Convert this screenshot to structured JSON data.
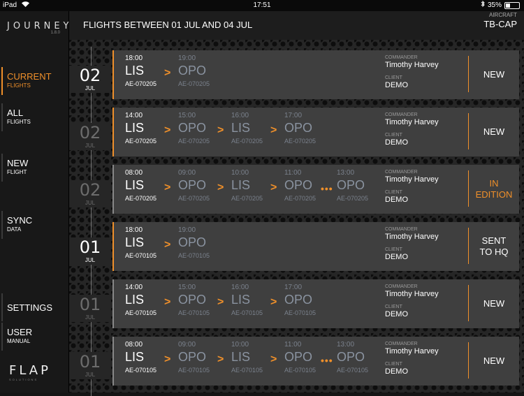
{
  "status_bar": {
    "device": "iPad",
    "time": "17:51",
    "battery": "35%",
    "battery_level": 0.35
  },
  "app": {
    "logo": "JOURNEY",
    "version": "1.8.0",
    "brand": "FLAP",
    "brand_sub": "SOLUTIONS"
  },
  "sidebar": {
    "items": [
      {
        "line1": "CURRENT",
        "line2": "FLIGHTS",
        "active": true
      },
      {
        "line1": "ALL",
        "line2": "FLIGHTS",
        "active": false
      },
      {
        "line1": "NEW",
        "line2": "FLIGHT",
        "active": false
      },
      {
        "line1": "SYNC",
        "line2": "DATA",
        "active": false
      },
      {
        "line1": "SETTINGS",
        "line2": "",
        "active": false
      },
      {
        "line1": "USER",
        "line2": "MANUAL",
        "active": false
      }
    ]
  },
  "header": {
    "title": "FLIGHTS BETWEEN 01 JUL AND 04 JUL",
    "aircraft_label": "AIRCRAFT",
    "aircraft": "TB-CAP"
  },
  "labels": {
    "commander": "COMMANDER",
    "client": "CLIENT"
  },
  "flights": [
    {
      "day": "02",
      "month": "JUL",
      "date_bright": true,
      "legs": [
        {
          "time": "18:00",
          "airport": "LIS",
          "flight": "AE-070205"
        },
        {
          "time": "19:00",
          "airport": "OPO",
          "flight": "AE-070205"
        }
      ],
      "seps": [
        ">"
      ],
      "commander": "Timothy Harvey",
      "client": "DEMO",
      "status": "NEW",
      "status_orange": false
    },
    {
      "day": "02",
      "month": "JUL",
      "date_bright": false,
      "legs": [
        {
          "time": "14:00",
          "airport": "LIS",
          "flight": "AE-070205"
        },
        {
          "time": "15:00",
          "airport": "OPO",
          "flight": "AE-070205"
        },
        {
          "time": "16:00",
          "airport": "LIS",
          "flight": "AE-070205"
        },
        {
          "time": "17:00",
          "airport": "OPO",
          "flight": "AE-070205"
        }
      ],
      "seps": [
        ">",
        ">",
        ">"
      ],
      "commander": "Timothy Harvey",
      "client": "DEMO",
      "status": "NEW",
      "status_orange": false
    },
    {
      "day": "02",
      "month": "JUL",
      "date_bright": false,
      "legs": [
        {
          "time": "08:00",
          "airport": "LIS",
          "flight": "AE-070205"
        },
        {
          "time": "09:00",
          "airport": "OPO",
          "flight": "AE-070205"
        },
        {
          "time": "10:00",
          "airport": "LIS",
          "flight": "AE-070205"
        },
        {
          "time": "11:00",
          "airport": "OPO",
          "flight": "AE-070205"
        },
        {
          "time": "13:00",
          "airport": "OPO",
          "flight": "AE-070205"
        }
      ],
      "seps": [
        ">",
        ">",
        ">",
        "•••"
      ],
      "commander": "Timothy Harvey",
      "client": "DEMO",
      "status": "IN\nEDITION",
      "status_orange": true
    },
    {
      "day": "01",
      "month": "JUL",
      "date_bright": true,
      "legs": [
        {
          "time": "18:00",
          "airport": "LIS",
          "flight": "AE-070105"
        },
        {
          "time": "19:00",
          "airport": "OPO",
          "flight": "AE-070105"
        }
      ],
      "seps": [
        ">"
      ],
      "commander": "Timothy Harvey",
      "client": "DEMO",
      "status": "SENT\nTO HQ",
      "status_orange": false
    },
    {
      "day": "01",
      "month": "JUL",
      "date_bright": false,
      "legs": [
        {
          "time": "14:00",
          "airport": "LIS",
          "flight": "AE-070105"
        },
        {
          "time": "15:00",
          "airport": "OPO",
          "flight": "AE-070105"
        },
        {
          "time": "16:00",
          "airport": "LIS",
          "flight": "AE-070105"
        },
        {
          "time": "17:00",
          "airport": "OPO",
          "flight": "AE-070105"
        }
      ],
      "seps": [
        ">",
        ">",
        ">"
      ],
      "commander": "Timothy Harvey",
      "client": "DEMO",
      "status": "NEW",
      "status_orange": false
    },
    {
      "day": "01",
      "month": "JUL",
      "date_bright": false,
      "legs": [
        {
          "time": "08:00",
          "airport": "LIS",
          "flight": "AE-070105"
        },
        {
          "time": "09:00",
          "airport": "OPO",
          "flight": "AE-070105"
        },
        {
          "time": "10:00",
          "airport": "LIS",
          "flight": "AE-070105"
        },
        {
          "time": "11:00",
          "airport": "OPO",
          "flight": "AE-070105"
        },
        {
          "time": "13:00",
          "airport": "OPO",
          "flight": "AE-070105"
        }
      ],
      "seps": [
        ">",
        ">",
        ">",
        "•••"
      ],
      "commander": "Timothy Harvey",
      "client": "DEMO",
      "status": "NEW",
      "status_orange": false
    }
  ]
}
